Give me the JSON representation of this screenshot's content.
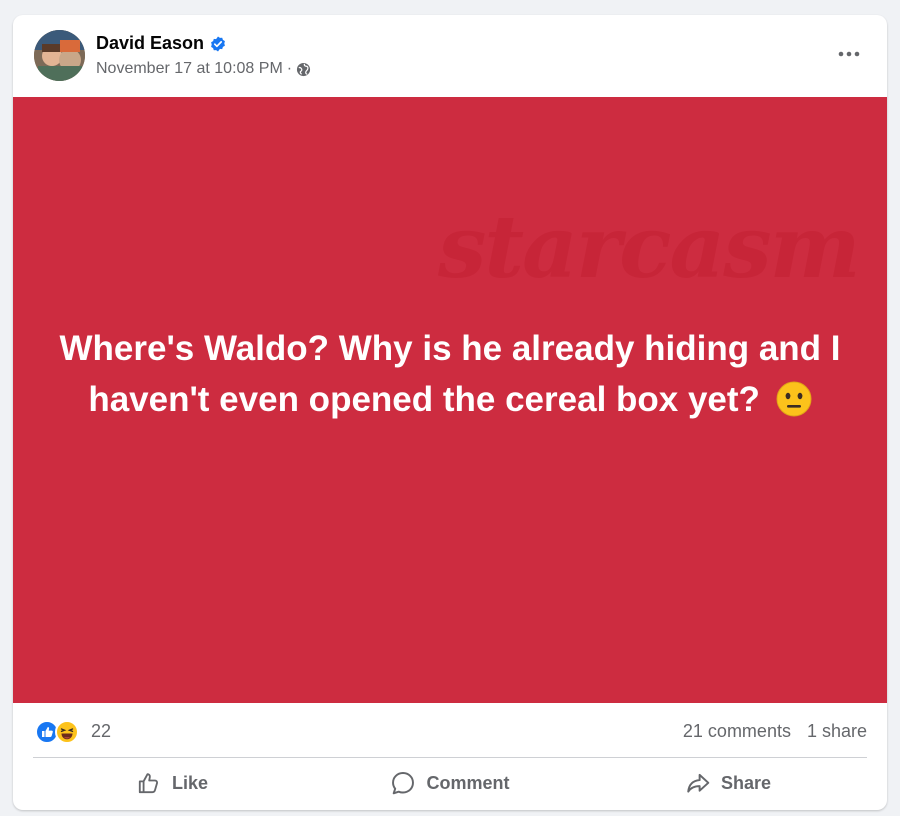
{
  "post": {
    "author": "David Eason",
    "timestamp": "November 17 at 10:08 PM",
    "separator": "·",
    "text": "Where's Waldo? Why is he already hiding and I haven't even opened the cereal box yet?",
    "emoji": "😐",
    "watermark": "starcasm",
    "background_color": "#cd2c40"
  },
  "stats": {
    "reaction_count": "22",
    "comments": "21 comments",
    "shares": "1 share",
    "reaction_icons": [
      "like-reaction-icon",
      "haha-reaction-icon"
    ]
  },
  "actions": {
    "like": "Like",
    "comment": "Comment",
    "share": "Share"
  },
  "colors": {
    "verified": "#1877f2",
    "like_blue": "#1877f2",
    "secondary_text": "#65676b"
  }
}
